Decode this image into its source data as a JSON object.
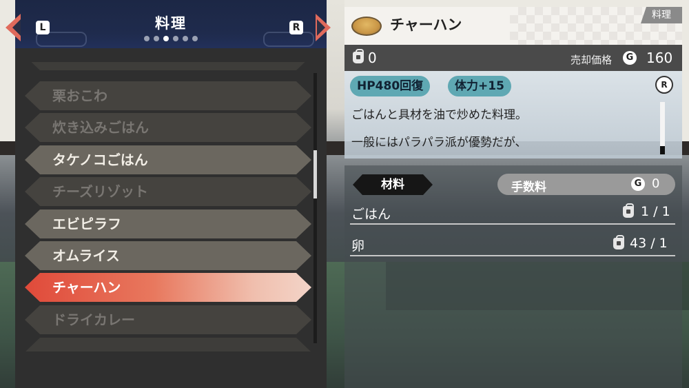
{
  "header": {
    "title": "料理",
    "left_button": "L",
    "right_button": "R",
    "page_dots": 6,
    "active_dot": 3
  },
  "recipe_list": [
    {
      "label": "栗おこわ",
      "state": "dim"
    },
    {
      "label": "炊き込みごはん",
      "state": "dim"
    },
    {
      "label": "タケノコごはん",
      "state": "available"
    },
    {
      "label": "チーズリゾット",
      "state": "dim"
    },
    {
      "label": "エビピラフ",
      "state": "available"
    },
    {
      "label": "オムライス",
      "state": "available"
    },
    {
      "label": "チャーハン",
      "state": "selected"
    },
    {
      "label": "ドライカレー",
      "state": "dim"
    }
  ],
  "detail": {
    "name": "チャーハン",
    "category_tag": "料理",
    "owned_count": "0",
    "sell_label": "売却価格",
    "sell_price": "160",
    "effects": [
      "HP480回復",
      "体力+15"
    ],
    "scroll_button": "R",
    "description_lines": [
      "ごはんと具材を油で炒めた料理。",
      "一般にはパラパラ派が優勢だが、"
    ]
  },
  "materials": {
    "header_label": "材料",
    "fee_label": "手数料",
    "fee_value": "0",
    "items": [
      {
        "name": "ごはん",
        "qty": "1 / 1"
      },
      {
        "name": "卵",
        "qty": "43 / 1"
      }
    ]
  },
  "currency_icon": "G",
  "colors": {
    "selected_start": "#e04a3a",
    "header_bg": "#1f2b4d",
    "effect_pill": "#5fa8b3",
    "arrow": "#e06a5c"
  }
}
